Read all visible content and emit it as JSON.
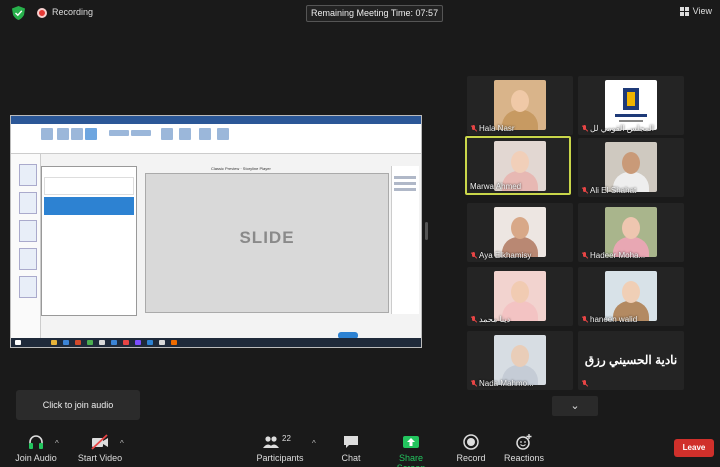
{
  "top_bar": {
    "recording_label": "Recording",
    "meeting_timer": "Remaining Meeting Time: 07:57",
    "view_label": "View"
  },
  "shared_screen": {
    "slide_label": "SLIDE",
    "player_title": "Classic Preview · Storyline Player"
  },
  "participants": [
    {
      "name": "Hala Nasr",
      "muted": true,
      "active": false,
      "type": "photo"
    },
    {
      "name": "المجلس القومي لل",
      "muted": true,
      "active": false,
      "type": "logo"
    },
    {
      "name": "Marwa Ahmed",
      "muted": false,
      "active": true,
      "type": "photo"
    },
    {
      "name": "Ali El-Shahat",
      "muted": true,
      "active": false,
      "type": "photo"
    },
    {
      "name": "Aya Elkhamisy",
      "muted": true,
      "active": false,
      "type": "photo"
    },
    {
      "name": "Hadeer Moha...",
      "muted": true,
      "active": false,
      "type": "photo"
    },
    {
      "name": "دينا محمد",
      "muted": true,
      "active": false,
      "type": "photo"
    },
    {
      "name": "haneen walid",
      "muted": true,
      "active": false,
      "type": "photo"
    },
    {
      "name": "Nada Mahmo...",
      "muted": true,
      "active": false,
      "type": "photo"
    },
    {
      "name": "نادية الحسيني رزق",
      "muted": true,
      "active": false,
      "type": "text"
    }
  ],
  "tooltip": {
    "text": "Click to join audio"
  },
  "toolbar": {
    "join_audio": "Join Audio",
    "start_video": "Start Video",
    "participants_label": "Participants",
    "participants_count": "22",
    "chat": "Chat",
    "share_screen": "Share Screen",
    "record": "Record",
    "reactions": "Reactions",
    "leave": "Leave"
  },
  "colors": {
    "background": "#1a1a1a",
    "active_speaker_border": "#c9d64a",
    "share_green": "#23c55e",
    "leave_red": "#d0302b",
    "muted_red": "#e84545"
  },
  "icons": {
    "security": "shield-icon",
    "recording": "record-dot-icon",
    "view": "grid-icon",
    "join_audio": "headphones-icon",
    "start_video": "video-off-icon",
    "participants": "people-icon",
    "chat": "chat-bubble-icon",
    "share_screen": "share-arrow-icon",
    "record": "record-icon",
    "reactions": "smiley-plus-icon"
  }
}
